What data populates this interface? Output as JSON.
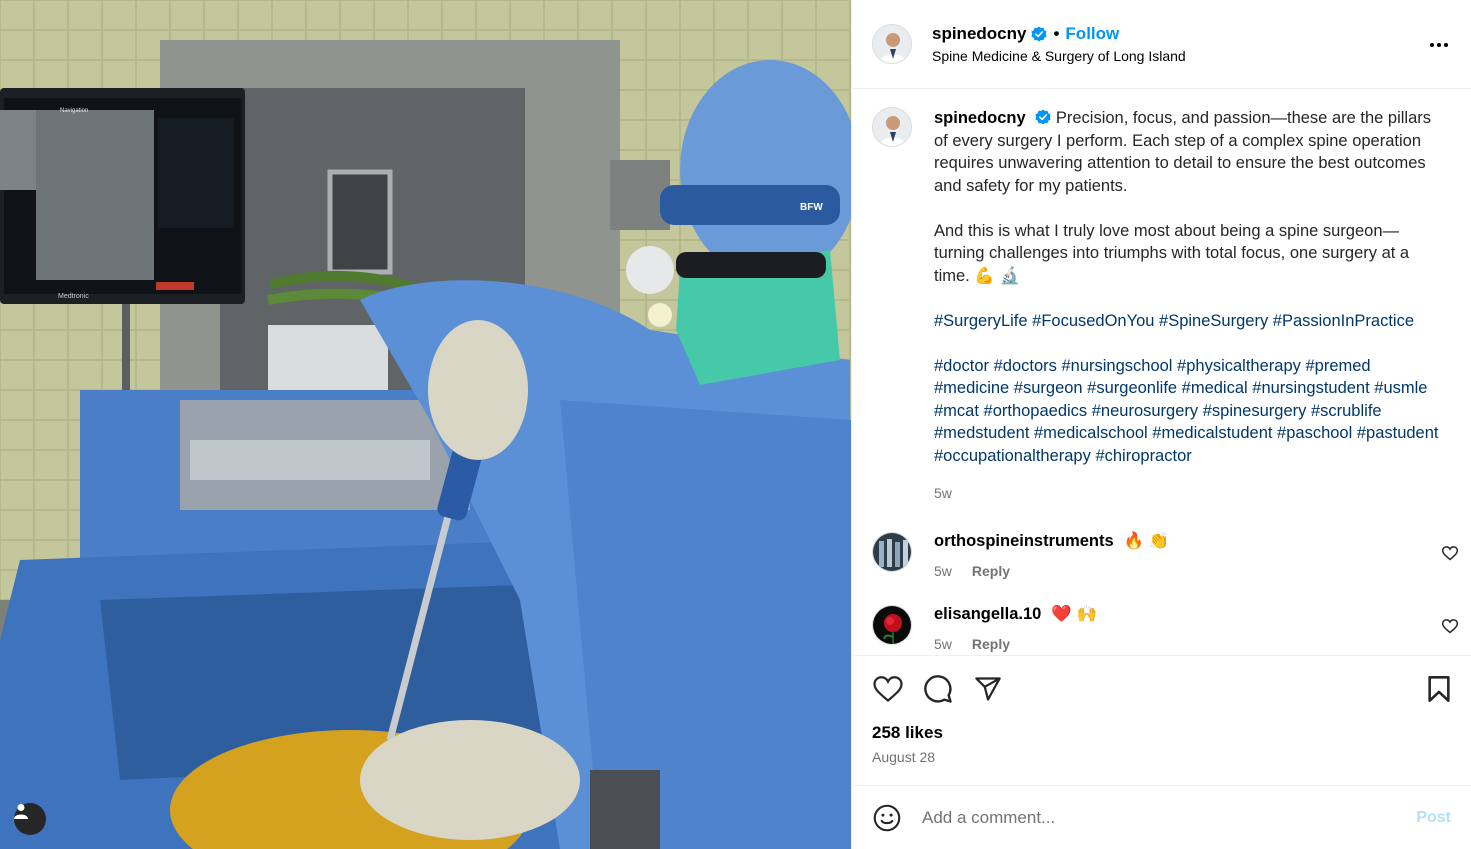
{
  "header": {
    "username": "spinedocny",
    "follow_label": "Follow",
    "dot": "•",
    "subtitle": "Spine Medicine & Surgery of Long Island",
    "more_icon": "more-horizontal-icon"
  },
  "caption": {
    "username": "spinedocny",
    "para1": "Precision, focus, and passion—these are the pillars of every surgery I perform. Each step of a complex spine operation requires unwavering attention to detail to ensure the best outcomes and safety for my patients.",
    "para2": "And this is what I truly love most about being a spine surgeon—turning challenges into triumphs with total focus, one surgery at a time. 💪 🔬",
    "tags1": "#SurgeryLife #FocusedOnYou #SpineSurgery #PassionInPractice",
    "tags2": "#doctor #doctors #nursingschool #physicaltherapy #premed #medicine #surgeon #surgeonlife #medical #nursingstudent #usmle #mcat #orthopaedics #neurosurgery #spinesurgery #scrublife #medstudent #medicalschool #medicalstudent #paschool #pastudent #occupationaltherapy #chiropractor",
    "time": "5w"
  },
  "comments": [
    {
      "username": "orthospineinstruments",
      "text": "🔥 👏",
      "time": "5w",
      "reply": "Reply"
    },
    {
      "username": "elisangella.10",
      "text": "❤️ 🙌",
      "time": "5w",
      "reply": "Reply"
    }
  ],
  "actions": {
    "likes": "258 likes",
    "date": "August 28"
  },
  "add_comment": {
    "placeholder": "Add a comment...",
    "post_label": "Post"
  },
  "photo": {
    "monitor_title": "Navigation",
    "monitor_brand": "Medtronic"
  },
  "colors": {
    "link_blue": "#0095f6",
    "hashtag": "#00376b",
    "muted": "#737373",
    "post_disabled": "#b2dffc"
  }
}
